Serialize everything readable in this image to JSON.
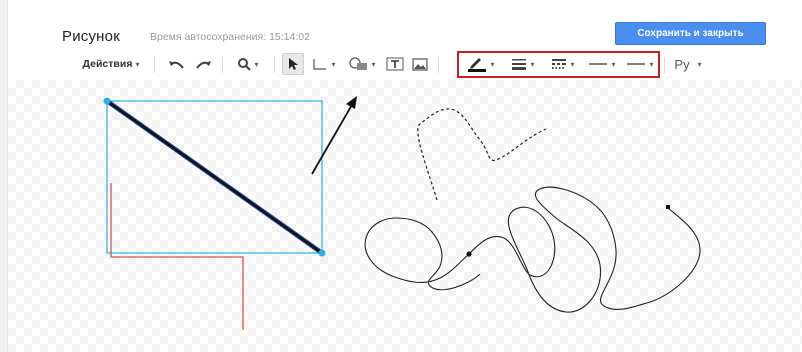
{
  "header": {
    "title": "Рисунок",
    "autosave": "Время автосохранения: 15:14:02",
    "save_close_label": "Сохранить и закрыть"
  },
  "toolbar": {
    "actions_label": "Действия",
    "language_label": "Ру",
    "icons": [
      "undo-icon",
      "redo-icon",
      "zoom-icon",
      "select-pointer-icon",
      "line-tool-icon",
      "shape-tool-icon",
      "text-box-icon",
      "image-icon",
      "line-color-icon",
      "line-weight-icon",
      "line-dash-icon",
      "line-start-icon",
      "line-end-icon"
    ]
  },
  "colors": {
    "accent": "#4a8ef0",
    "highlight": "#cc1f1f",
    "selection": "#2bb0e6",
    "red_line": "#d9534f"
  }
}
